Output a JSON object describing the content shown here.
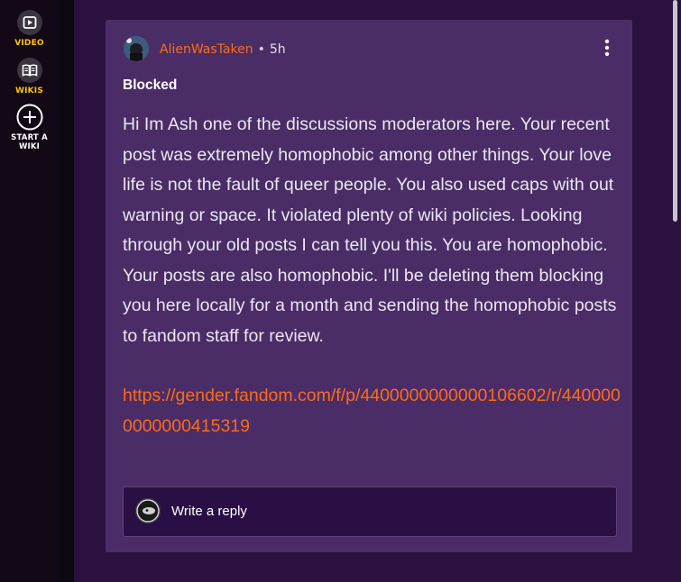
{
  "sidebar": {
    "items": [
      {
        "label": "VIDEO",
        "icon": "video-play-icon"
      },
      {
        "label": "WIKIS",
        "icon": "book-icon"
      },
      {
        "label": "START A\nWIKI",
        "icon": "plus-circle-icon"
      }
    ]
  },
  "post": {
    "author": "AlienWasTaken",
    "separator": "•",
    "time": "5h",
    "title": "Blocked",
    "body": "Hi Im Ash one of the discussions moderators here. Your recent post was extremely homophobic among other things. Your love life is not the fault of queer people. You also used caps with out warning or space. It violated plenty of wiki policies. Looking through your old posts I can tell you this. You are homophobic. Your posts are also homophobic. I'll be deleting them blocking you here locally for a month and sending the homophobic posts to fandom staff for review.",
    "link": "https://gender.fandom.com/f/p/4400000000000106602/r/4400000000000415319",
    "more_icon": "vertical-ellipsis-icon"
  },
  "reply": {
    "placeholder": "Write a reply"
  },
  "colors": {
    "accent": "#ff6a1a",
    "nav_accent": "#ffc500",
    "card": "#4a2d66",
    "page": "#2a1140"
  }
}
